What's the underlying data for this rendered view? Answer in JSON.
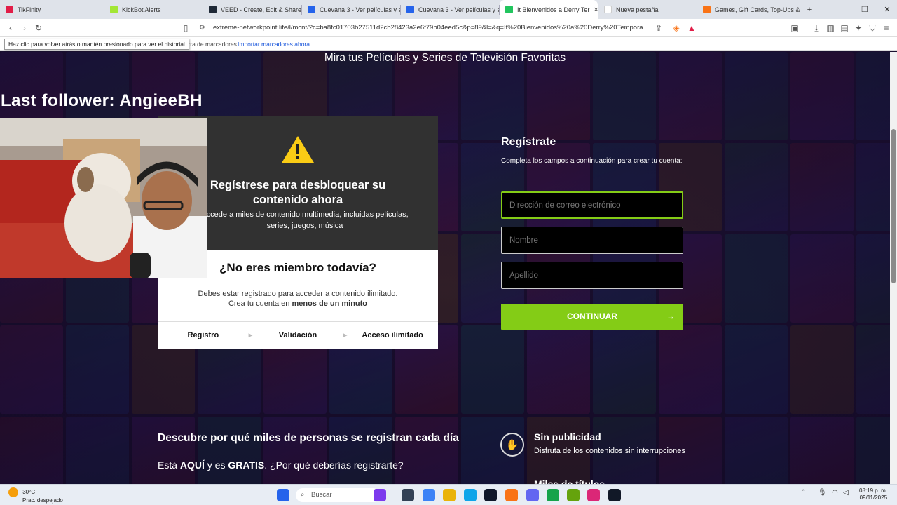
{
  "browser": {
    "tabs": [
      {
        "title": "TikFinity",
        "color": "#e11d48",
        "active": false
      },
      {
        "title": "KickBot Alerts",
        "color": "#a3e635",
        "active": false
      },
      {
        "title": "VEED - Create, Edit & Share Vi",
        "color": "#1f2937",
        "active": false
      },
      {
        "title": "Cuevana 3 - Ver películas y se",
        "color": "#2563eb",
        "active": false
      },
      {
        "title": "Cuevana 3 - Ver películas y se",
        "color": "#2563eb",
        "active": false
      },
      {
        "title": "It Bienvenidos a Derry Ter",
        "color": "#22c55e",
        "active": true
      },
      {
        "title": "Nueva pestaña",
        "color": "#ffffff",
        "active": false
      },
      {
        "title": "Games, Gift Cards, Top-Ups &",
        "color": "#f97316",
        "active": false
      }
    ],
    "url": "extreme-networkpoint.life/l/mcnt/?c=ba8fc01703b27511d2cb28423a2e6f79b04eed5c&p=89&l=&q=It%20Bienvenidos%20a%20Derry%20Tempora...",
    "tooltip": "Haz clic para volver atrás o mantén presionado para ver el historial",
    "bookmarks_text": "la barra de marcadores.",
    "bookmarks_link": "Importar marcadores ahora..."
  },
  "overlay": {
    "last_follower": "Last follower: AngieeBH"
  },
  "page": {
    "subtitle": "Mira tus Películas y Series de Televisión Favoritas",
    "unlock": {
      "title": "Regístrese para desbloquear su contenido ahora",
      "subtitle": "Accede a miles de contenido multimedia, incluidas películas, series, juegos, música"
    },
    "member": {
      "title": "¿No eres miembro todavía?",
      "text_line1": "Debes estar registrado para acceder a contenido ilimitado.",
      "text_line2_prefix": "Crea tu cuenta en",
      "text_line2_bold": "menos de un minuto",
      "steps": [
        "Registro",
        "Validación",
        "Acceso ilimitado"
      ]
    },
    "register": {
      "title": "Regístrate",
      "subtitle": "Completa los campos a continuación para crear tu cuenta:",
      "email_placeholder": "Dirección de correo electrónico",
      "name_placeholder": "Nombre",
      "lastname_placeholder": "Apellido",
      "continue_label": "CONTINUAR"
    },
    "why": {
      "title": "Descubre por qué miles de personas se registran cada día",
      "text_prefix": "Está",
      "text_bold1": "AQUÍ",
      "text_mid": "y es",
      "text_bold2": "GRATIS",
      "text_suffix": ". ¿Por qué deberías registrarte?"
    },
    "features": [
      {
        "title": "Sin publicidad",
        "desc": "Disfruta de los contenidos sin interrupciones"
      },
      {
        "title": "Miles de títulos",
        "desc": ""
      }
    ],
    "accent_color": "#84cc16"
  },
  "taskbar": {
    "weather_temp": "30°C",
    "weather_desc": "Prac. despejado",
    "search_placeholder": "Buscar",
    "time": "08:19 p. m.",
    "date": "09/11/2025"
  }
}
